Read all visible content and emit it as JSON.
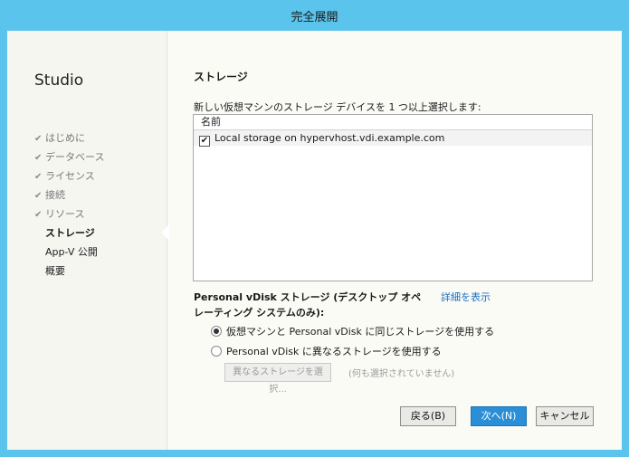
{
  "window": {
    "title": "完全展開"
  },
  "sidebar": {
    "app_name": "Studio",
    "steps": [
      {
        "label": "はじめに",
        "state": "done"
      },
      {
        "label": "データベース",
        "state": "done"
      },
      {
        "label": "ライセンス",
        "state": "done"
      },
      {
        "label": "接続",
        "state": "done"
      },
      {
        "label": "リソース",
        "state": "done"
      },
      {
        "label": "ストレージ",
        "state": "current"
      },
      {
        "label": "App-V 公開",
        "state": "pending"
      },
      {
        "label": "概要",
        "state": "pending"
      }
    ],
    "check_glyph": "✔"
  },
  "main": {
    "section_title": "ストレージ",
    "instruction": "新しい仮想マシンのストレージ デバイスを 1 つ以上選択します:",
    "list": {
      "header": "名前",
      "rows": [
        {
          "label": "Local storage on hypervhost.vdi.example.com",
          "checked": true
        }
      ]
    },
    "pvd": {
      "title": "Personal vDisk ストレージ (デスクトップ オペレーティング システムのみ):",
      "details_link": "詳細を表示",
      "option_same": "仮想マシンと Personal vDisk に同じストレージを使用する",
      "option_diff": "Personal vDisk に異なるストレージを使用する",
      "selected": "same",
      "select_button": "異なるストレージを選択...",
      "none_selected": "(何も選択されていません)"
    }
  },
  "footer": {
    "back": "戻る(B)",
    "next": "次へ(N)",
    "cancel": "キャンセル"
  },
  "colors": {
    "titlebar": "#5ac4ec",
    "primary_button": "#2a8fd6",
    "link": "#1b6fc4"
  }
}
